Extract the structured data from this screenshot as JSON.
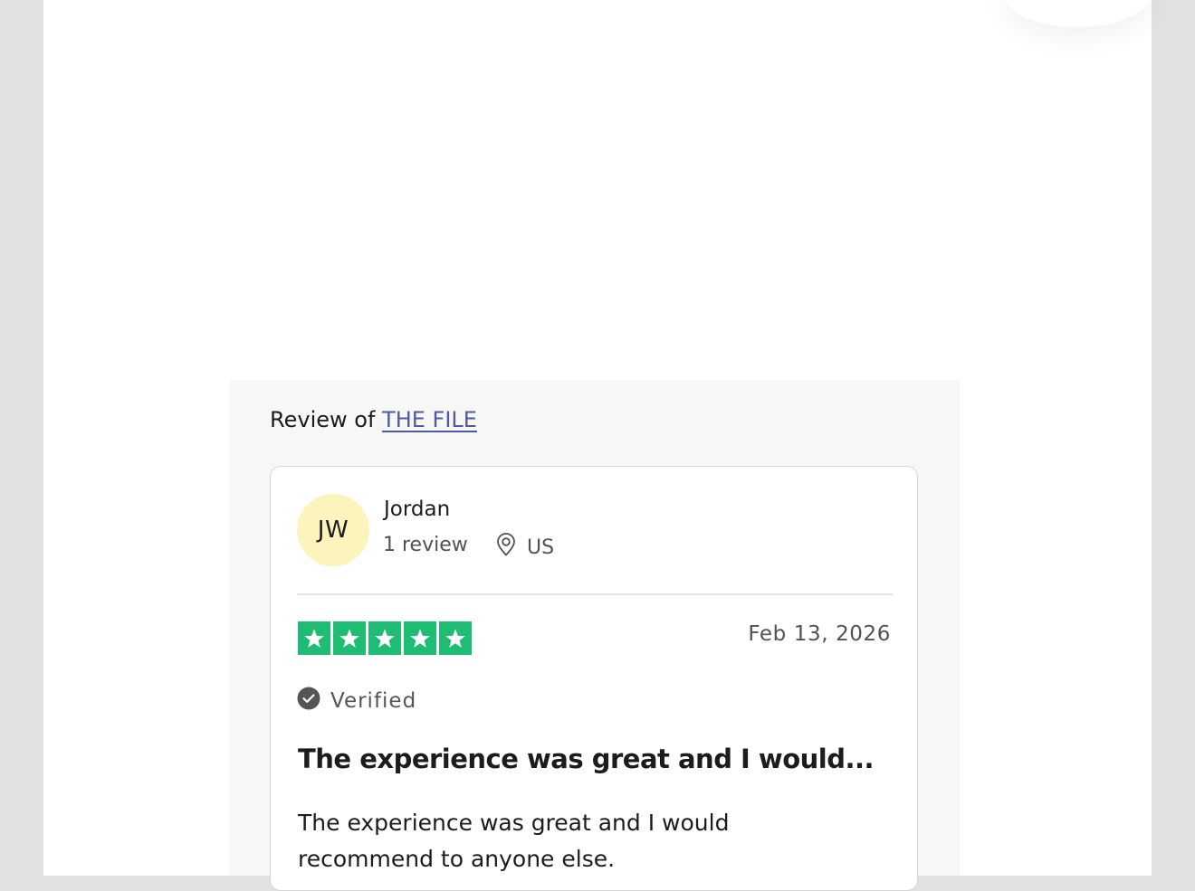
{
  "review": {
    "review_of_prefix": "Review of",
    "company_link": "THE FILE",
    "reviewer": {
      "initials": "JW",
      "name": "Jordan",
      "review_count": "1 review",
      "location": "US"
    },
    "rating": 5,
    "rating_max": 5,
    "date": "Feb 13, 2026",
    "verified_label": "Verified",
    "title": "The experience was great and I would...",
    "body": "The experience was great and I would recommend to anyone else."
  },
  "colors": {
    "star_green": "#1ebd73",
    "avatar_bg": "#fdf4bd",
    "link": "#5159a3",
    "panel_bg": "#f7f7f5"
  },
  "icons": {
    "location": "location-pin-icon",
    "verified": "check-circle-icon",
    "star": "star-icon"
  }
}
